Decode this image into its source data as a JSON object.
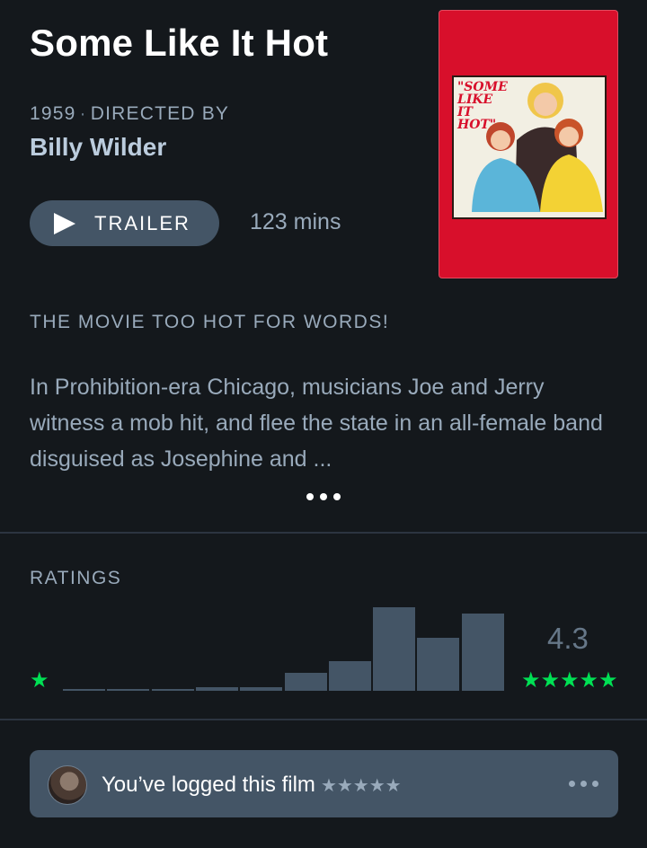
{
  "film": {
    "title": "Some Like It Hot",
    "year": "1959",
    "directed_by_label": "DIRECTED BY",
    "director": "Billy Wilder",
    "trailer_label": "TRAILER",
    "runtime": "123 mins",
    "poster_text": "\"SOME LIKE IT HOT\"",
    "tagline": "THE MOVIE TOO HOT FOR WORDS!",
    "synopsis": "In Prohibition-era Chicago, musicians Joe and Jerry witness a mob hit, and flee the state in an all-female band disguised as Josephine and ..."
  },
  "ratings": {
    "label": "RATINGS",
    "average": "4.3",
    "low_star": "★",
    "high_stars": "★★★★★",
    "histogram": [
      0.02,
      0.02,
      0.02,
      0.04,
      0.04,
      0.22,
      0.36,
      1.0,
      0.63,
      0.93
    ]
  },
  "log": {
    "text": "You’ve logged this film",
    "stars": "★★★★★"
  },
  "colors": {
    "background": "#14181c",
    "accent_green": "#00e054",
    "card": "#445566",
    "text_muted": "#99aabb",
    "poster_red": "#d80f2b"
  }
}
